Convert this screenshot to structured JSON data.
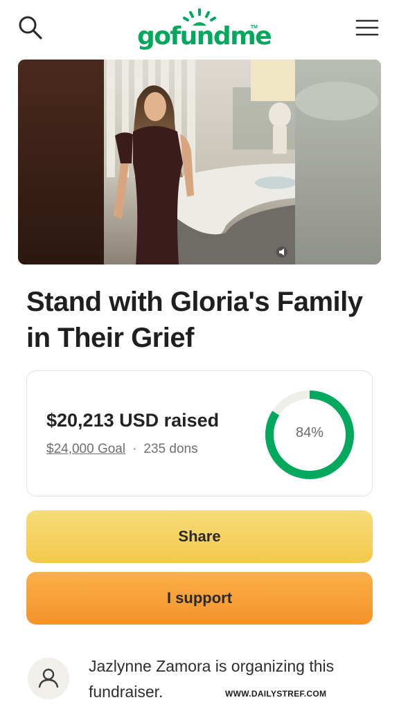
{
  "header": {
    "logo_text": "gofundme",
    "logo_trademark": "TM",
    "brand_color": "#02a95c",
    "search_icon": "search-icon",
    "menu_icon": "hamburger-menu-icon"
  },
  "campaign": {
    "title": "Stand with Gloria's Family in Their Grief",
    "media_icon": "volume-icon"
  },
  "stats": {
    "raised": "$20,213 USD raised",
    "goal": "$24,000 Goal",
    "separator": "·",
    "donations": "235 dons",
    "percent_label": "84%",
    "progress": 0.84,
    "progress_color": "#02a95c",
    "track_color": "#efeee9"
  },
  "actions": {
    "share_label": "Share",
    "support_label": "I support"
  },
  "organizer": {
    "text": "Jazlynne Zamora is organizing this fundraiser.",
    "avatar_icon": "user-icon"
  },
  "watermark": "WWW.DAILYSTREF.COM"
}
